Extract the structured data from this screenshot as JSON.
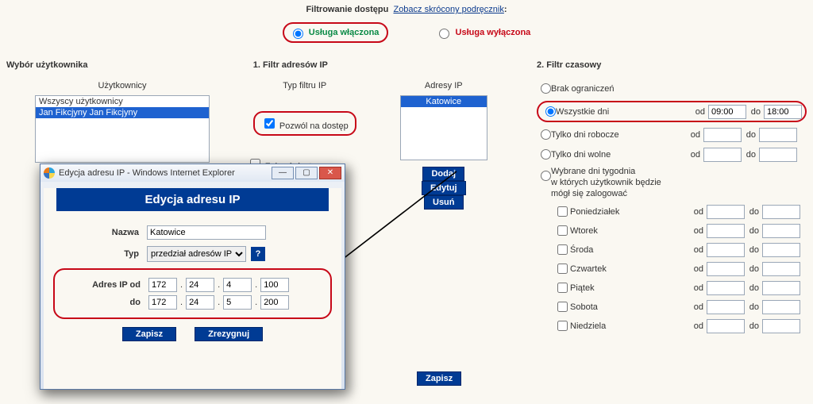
{
  "header": {
    "title": "Filtrowanie dostępu",
    "link": "Zobacz skrócony podręcznik",
    "colon": ":"
  },
  "service": {
    "on_label": "Usługa włączona",
    "off_label": "Usługa wyłączona"
  },
  "user_sel": {
    "title": "Wybór użytkownika",
    "list_label": "Użytkownicy",
    "items": [
      "Wszyscy użytkownicy",
      "Jan Fikcjyny Jan Fikcjyny"
    ]
  },
  "ip_filter": {
    "title": "1. Filtr adresów IP",
    "type_label": "Typ filtru IP",
    "addr_label": "Adresy IP",
    "allow": "Pozwól na dostęp",
    "deny": "Zabroń dostępu",
    "list": [
      "Katowice"
    ],
    "btn_add": "Dodaj",
    "btn_edit": "Edytuj",
    "btn_del": "Usuń"
  },
  "time_filter": {
    "title": "2. Filtr czasowy",
    "none": "Brak ograniczeń",
    "all_days": "Wszystkie dni",
    "work_days": "Tylko dni robocze",
    "free_days": "Tylko dni wolne",
    "custom_days": "Wybrane dni tygodnia\nw których użytkownik będzie\nmógł się zalogować",
    "od": "od",
    "do": "do",
    "all_from": "09:00",
    "all_to": "18:00",
    "days": [
      "Poniedziałek",
      "Wtorek",
      "Środa",
      "Czwartek",
      "Piątek",
      "Sobota",
      "Niedziela"
    ]
  },
  "popup": {
    "win_title": "Edycja adresu IP - Windows Internet Explorer",
    "banner": "Edycja adresu IP",
    "name_lbl": "Nazwa",
    "name_val": "Katowice",
    "type_lbl": "Typ",
    "type_val": "przedział adresów IP",
    "from_lbl": "Adres IP od",
    "to_lbl": "do",
    "from_ip": [
      "172",
      "24",
      "4",
      "100"
    ],
    "to_ip": [
      "172",
      "24",
      "5",
      "200"
    ],
    "save": "Zapisz",
    "cancel": "Zrezygnuj",
    "help": "?"
  },
  "bottom_save": "Zapisz"
}
